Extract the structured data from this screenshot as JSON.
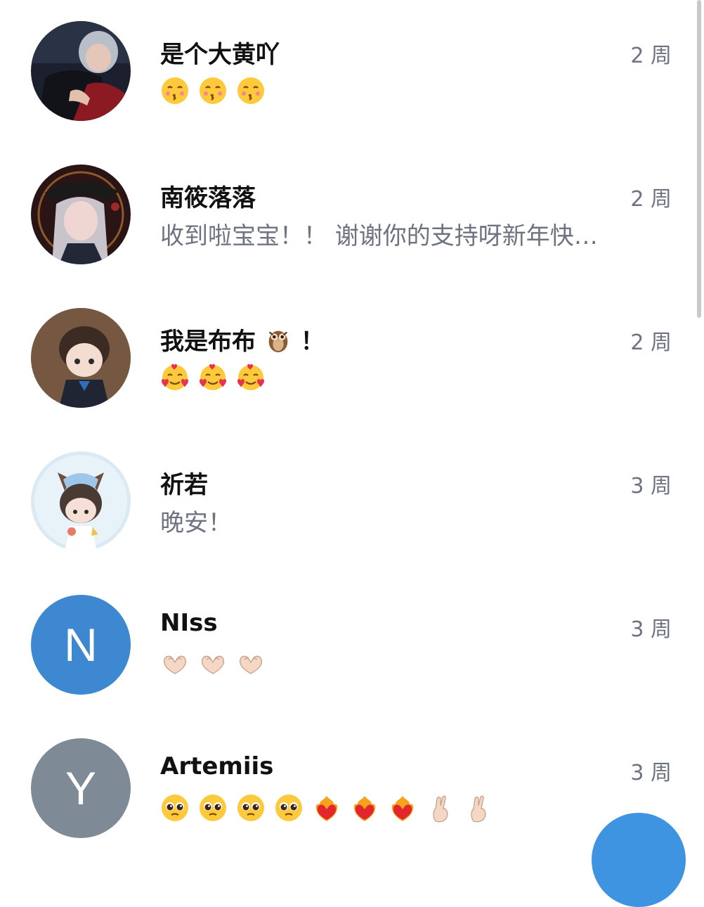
{
  "chats": [
    {
      "name": "是个大黄吖",
      "time": "2 周",
      "preview_emojis": [
        "kissing-face-emoji",
        "kissing-face-emoji",
        "kissing-face-emoji"
      ]
    },
    {
      "name": "南筱落落",
      "time": "2 周",
      "preview": "收到啦宝宝！！ 谢谢你的支持呀新年快乐！"
    },
    {
      "name": "我是布布",
      "name_suffix": "！",
      "name_emoji": "owl-emoji",
      "time": "2 周",
      "preview_emojis": [
        "smiling-face-with-hearts-emoji",
        "smiling-face-with-hearts-emoji",
        "smiling-face-with-hearts-emoji"
      ]
    },
    {
      "name": "祈若",
      "time": "3 周",
      "preview": "晚安！"
    },
    {
      "name": "NIss",
      "time": "3 周",
      "avatar_letter": "N",
      "avatar_color": "#3d88d1",
      "preview_emojis": [
        "heart-hands-emoji",
        "heart-hands-emoji",
        "heart-hands-emoji"
      ]
    },
    {
      "name": "Artemiis",
      "time": "3 周",
      "avatar_letter": "Y",
      "avatar_color": "#7e8b97",
      "preview_emojis": [
        "pleading-face-emoji",
        "pleading-face-emoji",
        "pleading-face-emoji",
        "pleading-face-emoji",
        "heart-on-fire-emoji",
        "heart-on-fire-emoji",
        "heart-on-fire-emoji",
        "crossed-fingers-emoji",
        "crossed-fingers-emoji"
      ]
    }
  ],
  "colors": {
    "accent": "#3f94e2",
    "meta_text": "#6d7480",
    "name_text": "#111111"
  }
}
